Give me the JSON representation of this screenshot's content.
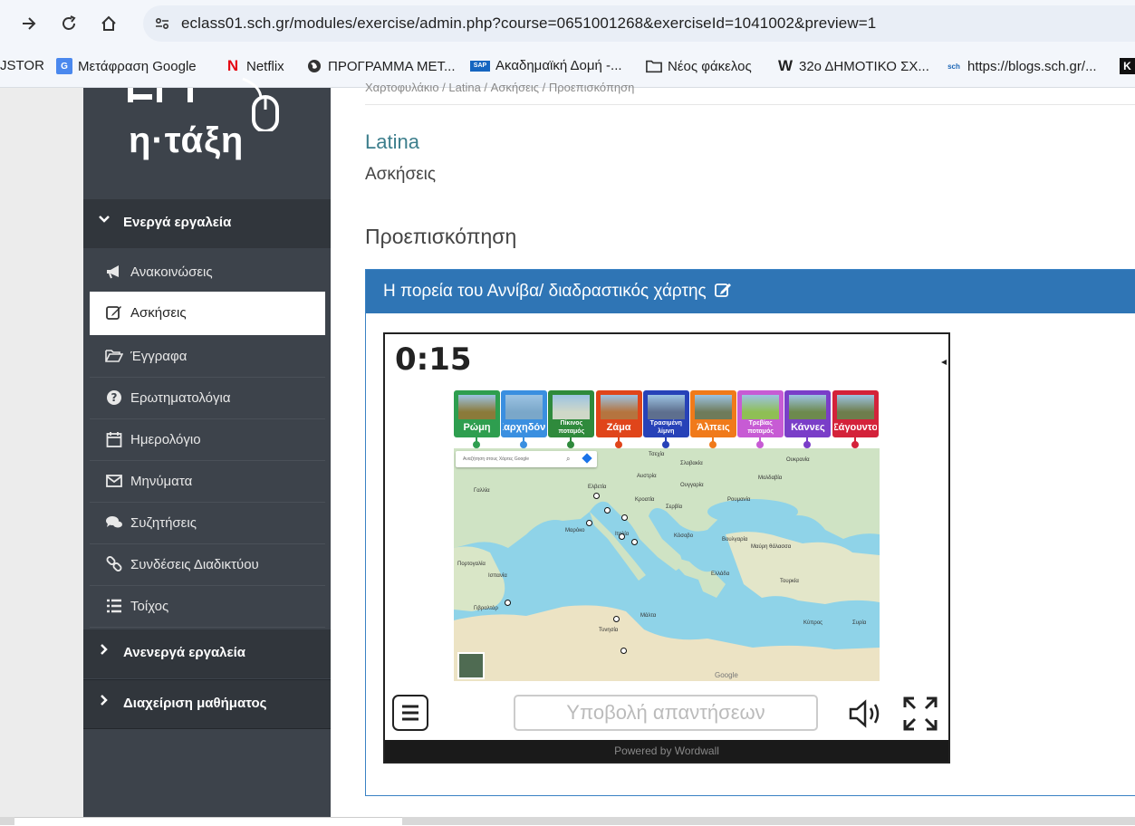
{
  "browser": {
    "url": "eclass01.sch.gr/modules/exercise/admin.php?course=0651001268&exerciseId=1041002&preview=1",
    "bookmarks": [
      {
        "label": "JSTOR",
        "icon": "none"
      },
      {
        "label": "Μετάφραση Google",
        "icon": "google-translate-icon"
      },
      {
        "label": "Netflix",
        "icon": "netflix-icon"
      },
      {
        "label": "ΠΡΟΓΡΑΜΜΑ ΜΕΤ...",
        "icon": "globe-icon"
      },
      {
        "label": "Ακαδημαϊκή Δομή -...",
        "icon": "sap-icon"
      },
      {
        "label": "Νέος φάκελος",
        "icon": "folder-icon"
      },
      {
        "label": "32ο ΔΗΜΟΤΙΚΟ ΣΧ...",
        "icon": "w-icon"
      },
      {
        "label": "https://blogs.sch.gr/...",
        "icon": "sch-icon"
      }
    ]
  },
  "logo": {
    "text": "η·τάξη"
  },
  "sidebar": {
    "sections": {
      "active": "Ενεργά εργαλεία",
      "inactive": "Ανενεργά εργαλεία",
      "admin": "Διαχείριση μαθήματος"
    },
    "items": [
      {
        "label": "Ανακοινώσεις",
        "icon": "megaphone-icon"
      },
      {
        "label": "Ασκήσεις",
        "icon": "edit-icon"
      },
      {
        "label": "Έγγραφα",
        "icon": "folder-open-icon"
      },
      {
        "label": "Ερωτηματολόγια",
        "icon": "question-icon"
      },
      {
        "label": "Ημερολόγιο",
        "icon": "calendar-icon"
      },
      {
        "label": "Μηνύματα",
        "icon": "envelope-icon"
      },
      {
        "label": "Συζητήσεις",
        "icon": "comments-icon"
      },
      {
        "label": "Συνδέσεις Διαδικτύου",
        "icon": "link-icon"
      },
      {
        "label": "Τοίχος",
        "icon": "list-icon"
      }
    ]
  },
  "main": {
    "breadcrumb": "Χαρτοφυλάκιο / Latina / Ασκήσεις / Προεπισκόπηση",
    "course_title": "Latina",
    "subtitle": "Ασκήσεις",
    "preview_heading": "Προεπισκόπηση",
    "panel_title": "Η πορεία του Αννίβα/ διαδραστικός χάρτης"
  },
  "activity": {
    "timer": "0:15",
    "tiles": [
      {
        "label": "Ρώμη",
        "color": "#2e9e4f",
        "img": "#8b7a3a"
      },
      {
        "label": "Καρχηδόνα",
        "color": "#3a8fe0",
        "img": "#7aa7c9"
      },
      {
        "label": "Πίκινος ποταμός",
        "color": "#2f8a3c",
        "img": "#cfd8c8"
      },
      {
        "label": "Ζάμα",
        "color": "#e0451a",
        "img": "#b5743f"
      },
      {
        "label": "Τρασιμένη λίμνη",
        "color": "#2742b8",
        "img": "#5e6f8e"
      },
      {
        "label": "Άλπεις",
        "color": "#f07a1a",
        "img": "#6f7b5a"
      },
      {
        "label": "Τρεβίας ποταμός",
        "color": "#c75bd4",
        "img": "#8fbf55"
      },
      {
        "label": "Κάννες",
        "color": "#7a3ec8",
        "img": "#6d8a4e"
      },
      {
        "label": "Σάγουντο",
        "color": "#d4223a",
        "img": "#6e7d4c"
      }
    ],
    "map_search_placeholder": "Αναζήτηση στους Χάρτες Google",
    "map_labels": [
      "Τσεχία",
      "Σλοβακία",
      "Αυστρία",
      "Ουγγαρία",
      "Μολδαβία",
      "Ουκρανία",
      "Γαλλία",
      "Ελβετία",
      "Κροατία",
      "Σερβία",
      "Ρουμανία",
      "Βουλγαρία",
      "Μαύρη θάλασσα",
      "Ιταλία",
      "Κόσοβο",
      "Ελλάδα",
      "Τουρκία",
      "Ισπανία",
      "Πορτογαλία",
      "Μαρόκο",
      "Τυνησία",
      "Μάλτα",
      "Κύπρος",
      "Συρία",
      "Γιβραλτάρ",
      "Google"
    ],
    "submit_label": "Υποβολή απαντήσεων",
    "powered_by": "Powered by Wordwall"
  }
}
